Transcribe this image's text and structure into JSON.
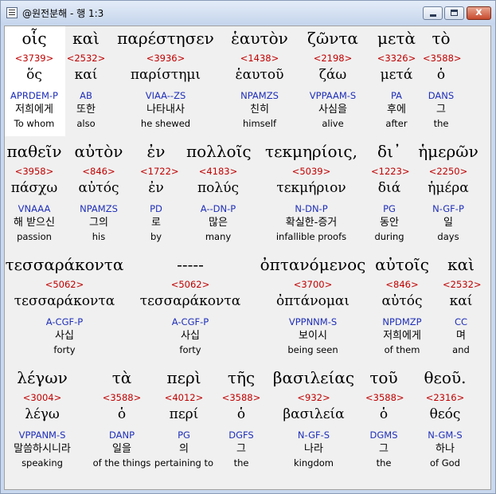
{
  "window": {
    "title": "@원전분해 - 행 1:3",
    "minimize_label": "",
    "maximize_label": "",
    "close_label": "x"
  },
  "colors": {
    "strong": "#c00000",
    "parsing": "#1f2fb8",
    "selection": "#ffffff"
  },
  "rows": [
    {
      "words": [
        {
          "greek": "οἷς",
          "strong": "<3739>",
          "lemma": "ὅς",
          "parsing": "APRDEM-P",
          "korean": "저희에게",
          "english": "To whom",
          "selected": true
        },
        {
          "greek": "καὶ",
          "strong": "<2532>",
          "lemma": "καί",
          "parsing": "AB",
          "korean": "또한",
          "english": "also"
        },
        {
          "greek": "παρέστησεν",
          "strong": "<3936>",
          "lemma": "παρίστημι",
          "parsing": "VIAA--ZS",
          "korean": "나타내사",
          "english": "he shewed"
        },
        {
          "greek": "ἑαυτὸν",
          "strong": "<1438>",
          "lemma": "ἑαυτοῦ",
          "parsing": "NPAMZS",
          "korean": "친히",
          "english": "himself"
        },
        {
          "greek": "ζῶντα",
          "strong": "<2198>",
          "lemma": "ζάω",
          "parsing": "VPPAAM-S",
          "korean": "사심을",
          "english": "alive"
        },
        {
          "greek": "μετὰ",
          "strong": "<3326>",
          "lemma": "μετά",
          "parsing": "PA",
          "korean": "후에",
          "english": "after"
        },
        {
          "greek": "τὸ",
          "strong": "<3588>",
          "lemma": "ὁ",
          "parsing": "DANS",
          "korean": "그",
          "english": "the"
        }
      ]
    },
    {
      "words": [
        {
          "greek": "παθεῖν",
          "strong": "<3958>",
          "lemma": "πάσχω",
          "parsing": "VNAAA",
          "korean": "해 받으신",
          "english": "passion"
        },
        {
          "greek": "αὐτὸν",
          "strong": "<846>",
          "lemma": "αὐτός",
          "parsing": "NPAMZS",
          "korean": "그의",
          "english": "his"
        },
        {
          "greek": "ἐν",
          "strong": "<1722>",
          "lemma": "ἐν",
          "parsing": "PD",
          "korean": "로",
          "english": "by"
        },
        {
          "greek": "πολλοῖς",
          "strong": "<4183>",
          "lemma": "πολύς",
          "parsing": "A--DN-P",
          "korean": "많은",
          "english": "many"
        },
        {
          "greek": "τεκμηρίοις,",
          "strong": "<5039>",
          "lemma": "τεκμήριον",
          "parsing": "N-DN-P",
          "korean": "확실한-증거",
          "english": "infallible proofs"
        },
        {
          "greek": "δι᾽",
          "strong": "<1223>",
          "lemma": "διά",
          "parsing": "PG",
          "korean": "동안",
          "english": "during"
        },
        {
          "greek": "ἡμερῶν",
          "strong": "<2250>",
          "lemma": "ἡμέρα",
          "parsing": "N-GF-P",
          "korean": "일",
          "english": "days"
        }
      ]
    },
    {
      "words": [
        {
          "greek": "τεσσαράκοντα",
          "strong": "<5062>",
          "lemma": "τεσσαράκοντα",
          "parsing": "A-CGF-P",
          "korean": "사십",
          "english": "forty"
        },
        {
          "greek": "-----",
          "strong": "<5062>",
          "lemma": "τεσσαράκοντα",
          "parsing": "A-CGF-P",
          "korean": "사십",
          "english": "forty"
        },
        {
          "greek": "ὀπτανόμενος",
          "strong": "<3700>",
          "lemma": "ὀπτάνομαι",
          "parsing": "VPPNNM-S",
          "korean": "보이시",
          "english": "being seen"
        },
        {
          "greek": "αὐτοῖς",
          "strong": "<846>",
          "lemma": "αὐτός",
          "parsing": "NPDMZP",
          "korean": "저희에게",
          "english": "of them"
        },
        {
          "greek": "καὶ",
          "strong": "<2532>",
          "lemma": "καί",
          "parsing": "CC",
          "korean": "며",
          "english": "and"
        }
      ]
    },
    {
      "words": [
        {
          "greek": "λέγων",
          "strong": "<3004>",
          "lemma": "λέγω",
          "parsing": "VPPANM-S",
          "korean": "말씀하시니라",
          "english": "speaking"
        },
        {
          "greek": "τὰ",
          "strong": "<3588>",
          "lemma": "ὁ",
          "parsing": "DANP",
          "korean": "일을",
          "english": "of the things"
        },
        {
          "greek": "περὶ",
          "strong": "<4012>",
          "lemma": "περί",
          "parsing": "PG",
          "korean": "의",
          "english": "pertaining to"
        },
        {
          "greek": "τῆς",
          "strong": "<3588>",
          "lemma": "ὁ",
          "parsing": "DGFS",
          "korean": "그",
          "english": "the"
        },
        {
          "greek": "βασιλείας",
          "strong": "<932>",
          "lemma": "βασιλεία",
          "parsing": "N-GF-S",
          "korean": "나라",
          "english": "kingdom"
        },
        {
          "greek": "τοῦ",
          "strong": "<3588>",
          "lemma": "ὁ",
          "parsing": "DGMS",
          "korean": "그",
          "english": "the"
        },
        {
          "greek": "θεοῦ.",
          "strong": "<2316>",
          "lemma": "θεός",
          "parsing": "N-GM-S",
          "korean": "하나",
          "english": "of God"
        }
      ]
    }
  ]
}
